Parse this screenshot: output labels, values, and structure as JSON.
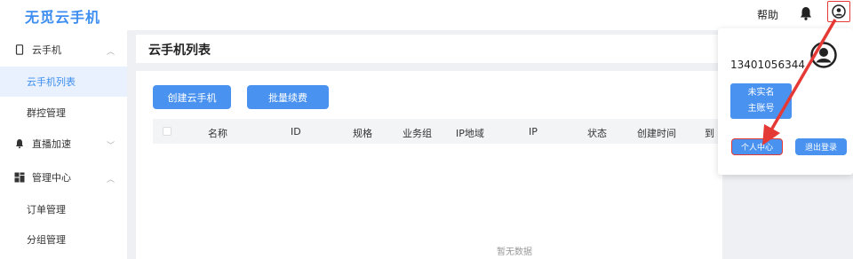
{
  "header": {
    "brand": "无觅云手机",
    "help_label": "帮助",
    "bell_icon": "bell-icon",
    "avatar_icon": "user-icon",
    "highlight_color": "#e53935"
  },
  "sidebar": {
    "items": [
      {
        "label": "云手机",
        "icon": "phone-icon",
        "expanded": true
      },
      {
        "label": "云手机列表",
        "active": true
      },
      {
        "label": "群控管理"
      },
      {
        "label": "直播加速",
        "icon": "bell-icon",
        "expanded": false
      },
      {
        "label": "管理中心",
        "icon": "grid-icon",
        "expanded": true
      },
      {
        "label": "订单管理"
      },
      {
        "label": "分组管理"
      }
    ]
  },
  "main": {
    "title": "云手机列表",
    "create_button": "创建云手机",
    "renew_button": "批量续费",
    "columns": [
      "名称",
      "ID",
      "规格",
      "业务组",
      "IP地域",
      "IP",
      "状态",
      "创建时间",
      "到"
    ],
    "empty_text": "暂无数据"
  },
  "account_popover": {
    "phone": "13401056344",
    "verify_line1": "未实名",
    "verify_line2": "主账号",
    "profile_button": "个人中心",
    "logout_button": "退出登录"
  },
  "colors": {
    "accent": "#4a92f0",
    "brand": "#3d8ef0",
    "annotation": "#e53935"
  }
}
